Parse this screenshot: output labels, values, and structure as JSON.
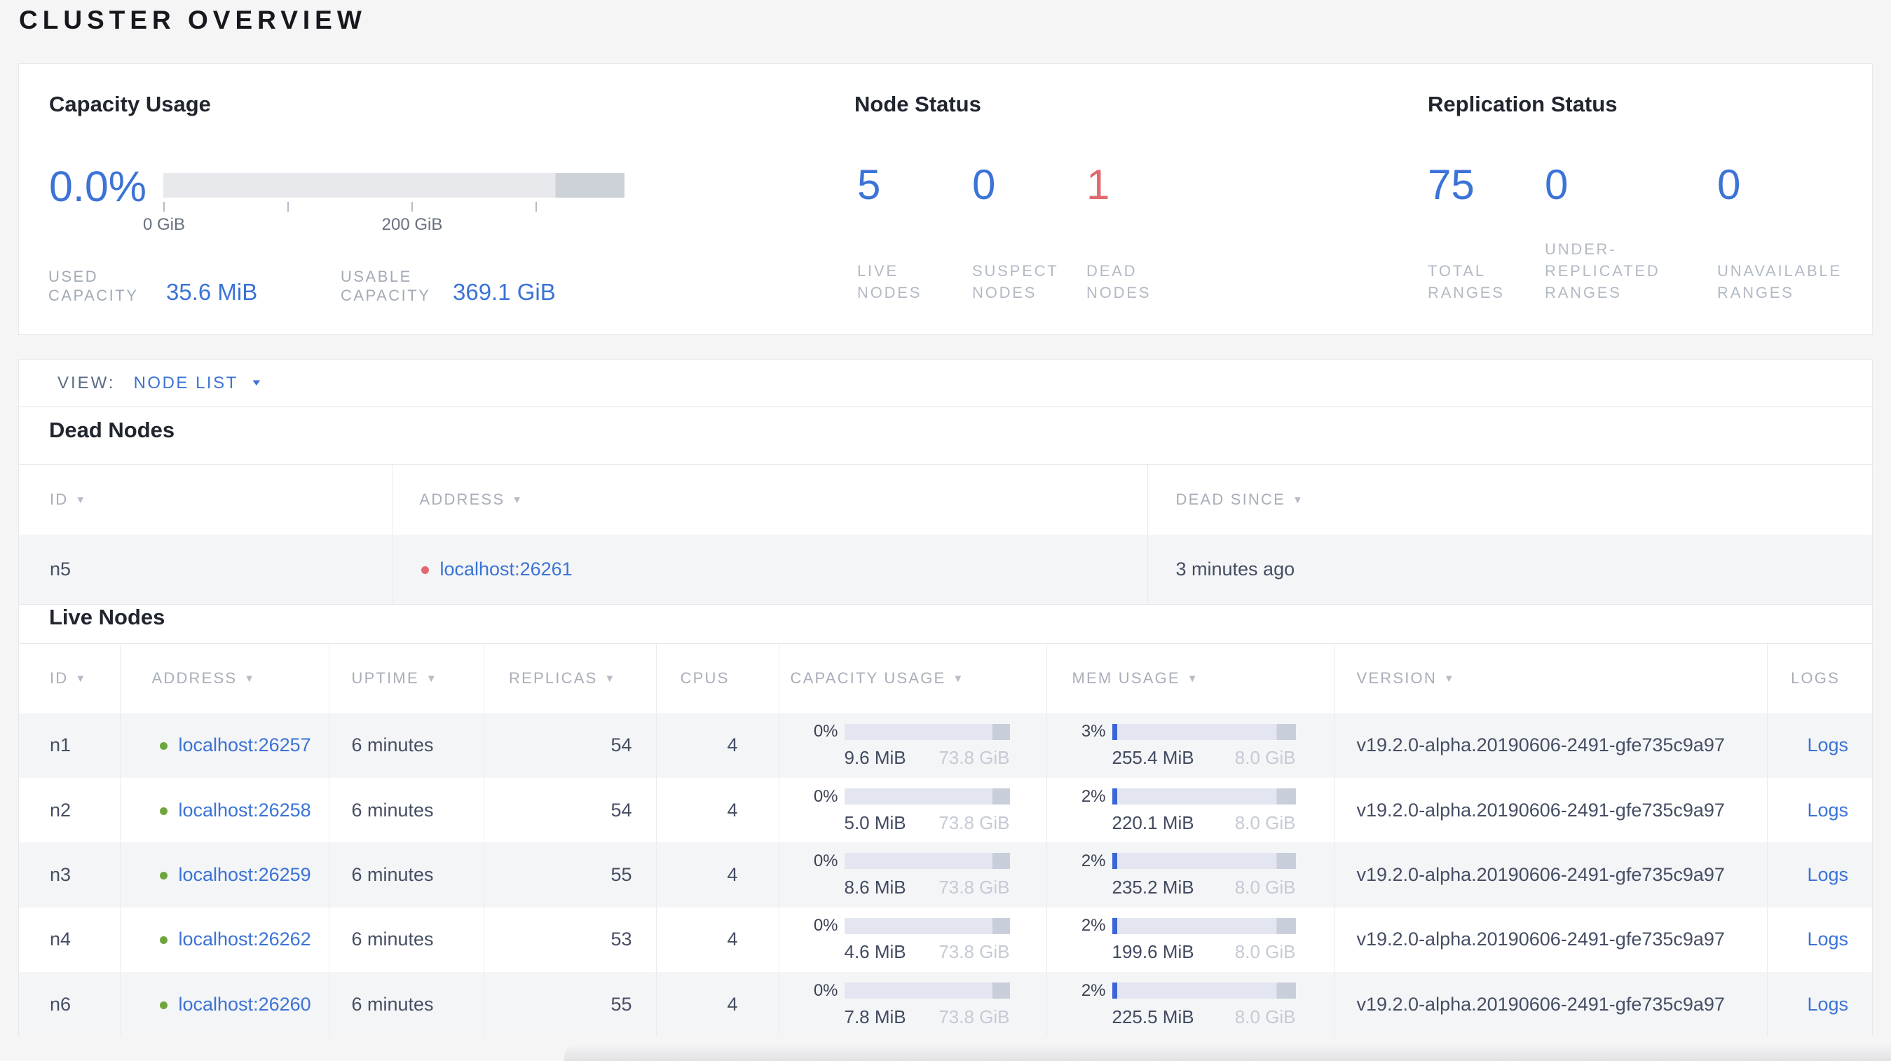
{
  "page": {
    "title": "CLUSTER OVERVIEW"
  },
  "icons": {
    "dropdown_caret": "▼",
    "sort_desc": "▼"
  },
  "colors": {
    "accent": "#3b73d6",
    "danger": "#e0696f",
    "live_dot": "#6fa63c"
  },
  "overview": {
    "capacity": {
      "heading": "Capacity Usage",
      "percent": "0.0%",
      "bar": {
        "dark_start_fraction": 0.85,
        "tick_labels": [
          "0 GiB",
          "200 GiB"
        ]
      },
      "stats": [
        {
          "key": "used-capacity",
          "label_lines": [
            "USED",
            "CAPACITY"
          ],
          "value": "35.6 MiB"
        },
        {
          "key": "usable-capacity",
          "label_lines": [
            "USABLE",
            "CAPACITY"
          ],
          "value": "369.1 GiB"
        }
      ]
    },
    "node_status": {
      "heading": "Node Status",
      "stats": [
        {
          "key": "live-nodes",
          "value": "5",
          "color": "blue",
          "label_lines": [
            "LIVE",
            "NODES"
          ]
        },
        {
          "key": "suspect-nodes",
          "value": "0",
          "color": "blue",
          "label_lines": [
            "SUSPECT",
            "NODES"
          ]
        },
        {
          "key": "dead-nodes",
          "value": "1",
          "color": "red",
          "label_lines": [
            "DEAD",
            "NODES"
          ]
        }
      ]
    },
    "replication": {
      "heading": "Replication Status",
      "stats": [
        {
          "key": "total-ranges",
          "value": "75",
          "color": "blue",
          "label_lines": [
            "TOTAL",
            "RANGES"
          ]
        },
        {
          "key": "under-replicated-ranges",
          "value": "0",
          "color": "blue",
          "label_lines": [
            "UNDER-",
            "REPLICATED",
            "RANGES"
          ]
        },
        {
          "key": "unavailable-ranges",
          "value": "0",
          "color": "blue",
          "label_lines": [
            "UNAVAILABLE",
            "RANGES"
          ]
        }
      ]
    }
  },
  "view_bar": {
    "label": "VIEW:",
    "selected": "NODE LIST"
  },
  "dead_nodes": {
    "heading": "Dead Nodes",
    "columns": [
      {
        "key": "id",
        "label": "ID",
        "sort": true
      },
      {
        "key": "address",
        "label": "ADDRESS",
        "sort": true
      },
      {
        "key": "dead_since",
        "label": "DEAD SINCE",
        "sort": true
      }
    ],
    "rows": [
      {
        "id": "n5",
        "status": "dead",
        "address": "localhost:26261",
        "dead_since": "3 minutes ago"
      }
    ]
  },
  "live_nodes": {
    "heading": "Live Nodes",
    "columns": [
      {
        "key": "id",
        "label": "ID",
        "sort": true
      },
      {
        "key": "address",
        "label": "ADDRESS",
        "sort": true
      },
      {
        "key": "uptime",
        "label": "UPTIME",
        "sort": true
      },
      {
        "key": "replicas",
        "label": "REPLICAS",
        "sort": true
      },
      {
        "key": "cpus",
        "label": "CPUS",
        "sort": false
      },
      {
        "key": "capacity",
        "label": "CAPACITY USAGE",
        "sort": true
      },
      {
        "key": "memory",
        "label": "MEM USAGE",
        "sort": true
      },
      {
        "key": "version",
        "label": "VERSION",
        "sort": true
      },
      {
        "key": "logs",
        "label": "LOGS",
        "sort": false
      }
    ],
    "rows": [
      {
        "id": "n1",
        "status": "live",
        "address": "localhost:26257",
        "uptime": "6 minutes",
        "replicas": "54",
        "cpus": "4",
        "capacity": {
          "percent": "0%",
          "pct": 0,
          "used": "9.6 MiB",
          "total": "73.8 GiB"
        },
        "memory": {
          "percent": "3%",
          "pct": 3,
          "used": "255.4 MiB",
          "total": "8.0 GiB"
        },
        "version": "v19.2.0-alpha.20190606-2491-gfe735c9a97",
        "logs_label": "Logs"
      },
      {
        "id": "n2",
        "status": "live",
        "address": "localhost:26258",
        "uptime": "6 minutes",
        "replicas": "54",
        "cpus": "4",
        "capacity": {
          "percent": "0%",
          "pct": 0,
          "used": "5.0 MiB",
          "total": "73.8 GiB"
        },
        "memory": {
          "percent": "2%",
          "pct": 2,
          "used": "220.1 MiB",
          "total": "8.0 GiB"
        },
        "version": "v19.2.0-alpha.20190606-2491-gfe735c9a97",
        "logs_label": "Logs"
      },
      {
        "id": "n3",
        "status": "live",
        "address": "localhost:26259",
        "uptime": "6 minutes",
        "replicas": "55",
        "cpus": "4",
        "capacity": {
          "percent": "0%",
          "pct": 0,
          "used": "8.6 MiB",
          "total": "73.8 GiB"
        },
        "memory": {
          "percent": "2%",
          "pct": 2,
          "used": "235.2 MiB",
          "total": "8.0 GiB"
        },
        "version": "v19.2.0-alpha.20190606-2491-gfe735c9a97",
        "logs_label": "Logs"
      },
      {
        "id": "n4",
        "status": "live",
        "address": "localhost:26262",
        "uptime": "6 minutes",
        "replicas": "53",
        "cpus": "4",
        "capacity": {
          "percent": "0%",
          "pct": 0,
          "used": "4.6 MiB",
          "total": "73.8 GiB"
        },
        "memory": {
          "percent": "2%",
          "pct": 2,
          "used": "199.6 MiB",
          "total": "8.0 GiB"
        },
        "version": "v19.2.0-alpha.20190606-2491-gfe735c9a97",
        "logs_label": "Logs"
      },
      {
        "id": "n6",
        "status": "live",
        "address": "localhost:26260",
        "uptime": "6 minutes",
        "replicas": "55",
        "cpus": "4",
        "capacity": {
          "percent": "0%",
          "pct": 0,
          "used": "7.8 MiB",
          "total": "73.8 GiB"
        },
        "memory": {
          "percent": "2%",
          "pct": 2,
          "used": "225.5 MiB",
          "total": "8.0 GiB"
        },
        "version": "v19.2.0-alpha.20190606-2491-gfe735c9a97",
        "logs_label": "Logs"
      }
    ]
  }
}
